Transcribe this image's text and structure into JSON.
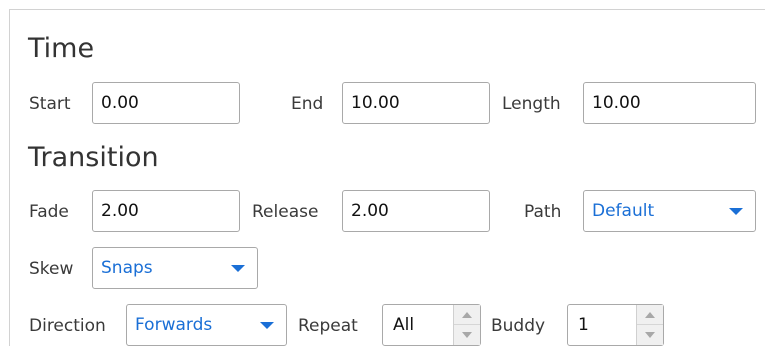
{
  "time": {
    "title": "Time",
    "start_label": "Start",
    "start_value": "0.00",
    "end_label": "End",
    "end_value": "10.00",
    "length_label": "Length",
    "length_value": "10.00"
  },
  "transition": {
    "title": "Transition",
    "fade_label": "Fade",
    "fade_value": "2.00",
    "release_label": "Release",
    "release_value": "2.00",
    "path_label": "Path",
    "path_value": "Default",
    "skew_label": "Skew",
    "skew_value": "Snaps",
    "direction_label": "Direction",
    "direction_value": "Forwards",
    "repeat_label": "Repeat",
    "repeat_value": "All",
    "buddy_label": "Buddy",
    "buddy_value": "1"
  },
  "colors": {
    "accent": "#1a6fd6",
    "border": "#a9a9a9"
  },
  "icons": {
    "dropdown": "chevron-down-icon",
    "spinner_up": "spinner-up-icon",
    "spinner_down": "spinner-down-icon"
  }
}
